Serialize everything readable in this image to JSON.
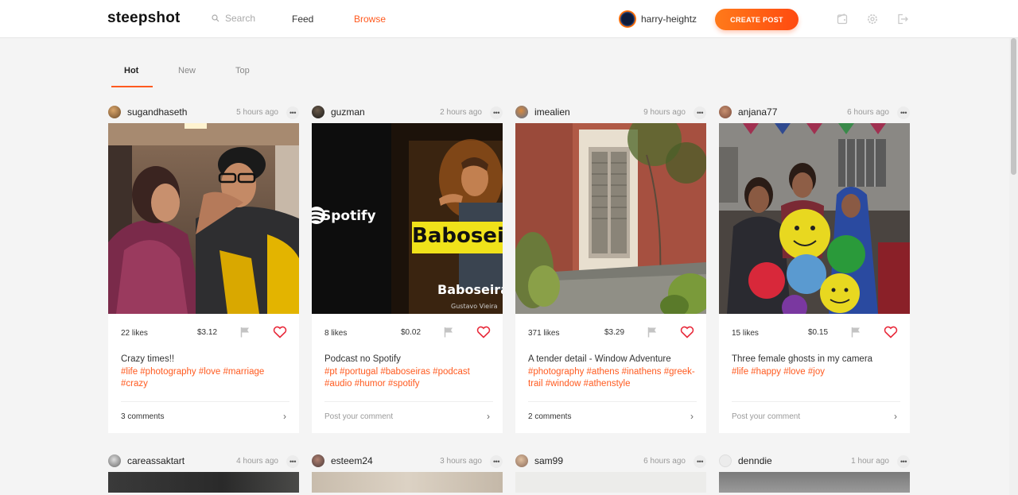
{
  "header": {
    "logo": "steepshot",
    "search_placeholder": "Search",
    "nav_feed": "Feed",
    "nav_browse": "Browse",
    "username": "harry-heightz",
    "create_post": "CREATE POST",
    "accent_color": "#ff5a1f",
    "icons": [
      "wallet-icon",
      "settings-icon",
      "logout-icon"
    ]
  },
  "tabs": [
    "Hot",
    "New",
    "Top"
  ],
  "active_tab": "Hot",
  "posts": [
    {
      "username": "sugandhaseth",
      "time": "5 hours ago",
      "likes": "22 likes",
      "payout": "$3.12",
      "title": "Crazy times!!",
      "tags": "#life #photography #love #marriage #crazy",
      "comments": "3 comments",
      "comments_is_placeholder": false
    },
    {
      "username": "guzman",
      "time": "2 hours ago",
      "likes": "8 likes",
      "payout": "$0.02",
      "title": "Podcast no Spotify",
      "tags": "#pt #portugal #baboseiras #podcast #audio #humor #spotify",
      "comments": "Post your comment",
      "comments_is_placeholder": true,
      "image_text": {
        "brand": "Spotify",
        "show": "Baboseiras",
        "show_cropped": "Babosei",
        "author": "Gustavo Vieira"
      }
    },
    {
      "username": "imealien",
      "time": "9 hours ago",
      "likes": "371 likes",
      "payout": "$3.29",
      "title": "A tender detail - Window Adventure",
      "tags": "#photography #athens #inathens #greek-trail #window #athenstyle",
      "comments": "2 comments",
      "comments_is_placeholder": false
    },
    {
      "username": "anjana77",
      "time": "6 hours ago",
      "likes": "15 likes",
      "payout": "$0.15",
      "title": "Three female ghosts in my camera",
      "tags": "#life #happy #love #joy",
      "comments": "Post your comment",
      "comments_is_placeholder": true
    }
  ],
  "posts_row2": [
    {
      "username": "careassaktart",
      "time": "4 hours ago"
    },
    {
      "username": "esteem24",
      "time": "3 hours ago"
    },
    {
      "username": "sam99",
      "time": "6 hours ago"
    },
    {
      "username": "denndie",
      "time": "1 hour ago"
    }
  ],
  "more_label": "•••"
}
